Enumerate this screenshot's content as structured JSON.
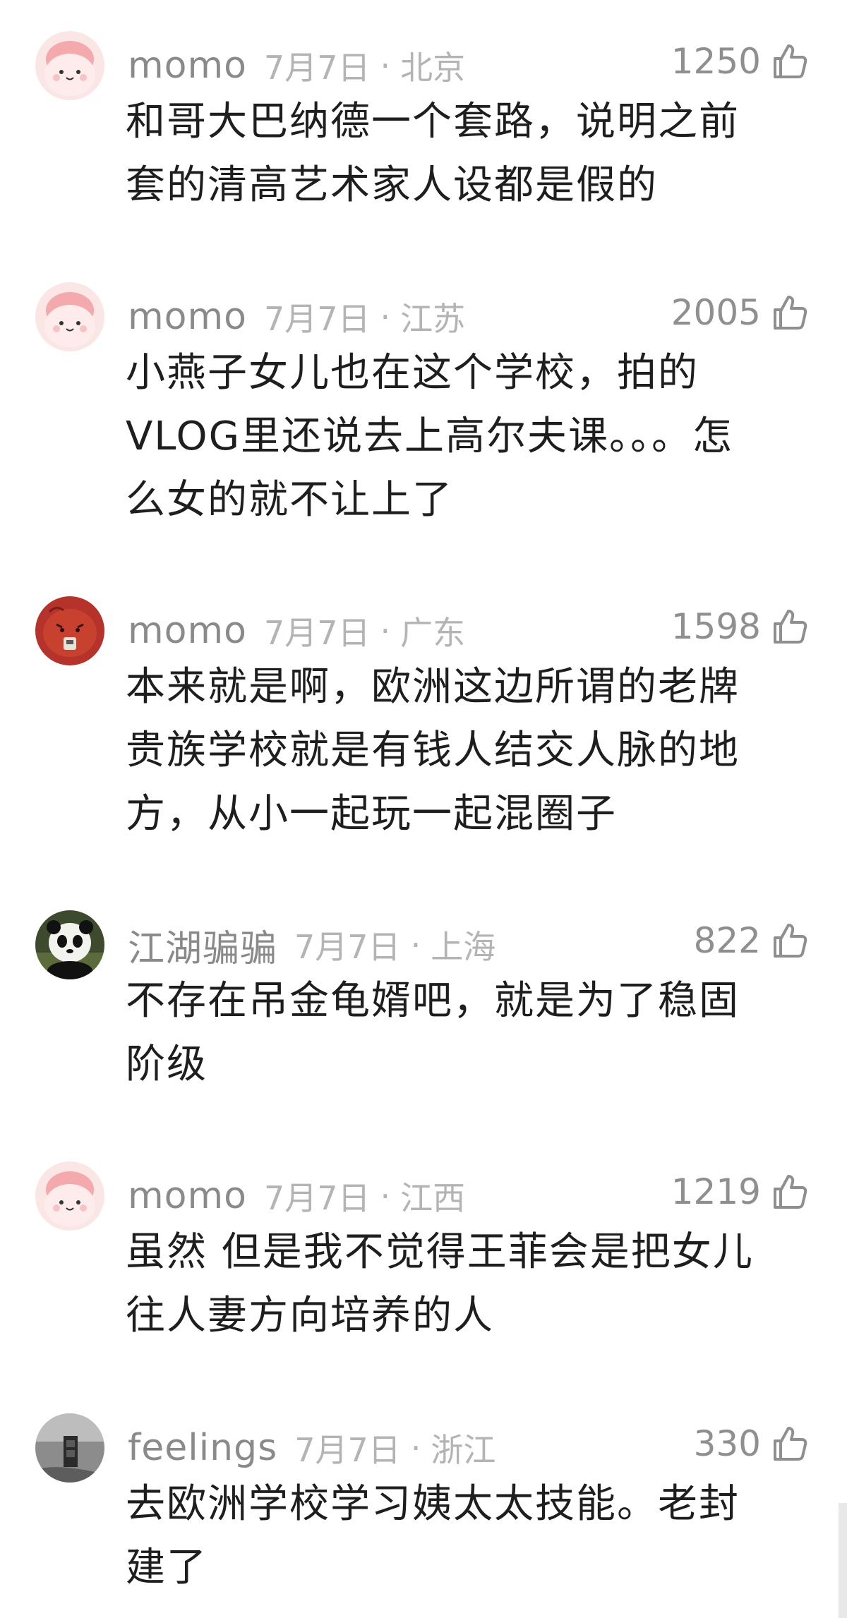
{
  "comments": [
    {
      "username": "momo",
      "date": "7月7日",
      "location": "北京",
      "likes": "1250",
      "avatar": "pink-bunny-avatar",
      "lines": [
        "和哥大巴纳德一个套路，说明之前",
        "套的清高艺术家人设都是假的"
      ]
    },
    {
      "username": "momo",
      "date": "7月7日",
      "location": "江苏",
      "likes": "2005",
      "avatar": "pink-bunny-avatar",
      "lines": [
        "小燕子女儿也在这个学校，拍的",
        "VLOG里还说去上高尔夫课。。。怎",
        "么女的就不让上了"
      ]
    },
    {
      "username": "momo",
      "date": "7月7日",
      "location": "广东",
      "likes": "1598",
      "avatar": "red-cartoon-avatar",
      "lines": [
        "本来就是啊，欧洲这边所谓的老牌",
        "贵族学校就是有钱人结交人脉的地",
        "方，从小一起玩一起混圈子"
      ]
    },
    {
      "username": "江湖骗骗",
      "date": "7月7日",
      "location": "上海",
      "likes": "822",
      "avatar": "panda-avatar",
      "lines": [
        "不存在吊金龟婿吧，就是为了稳固",
        "阶级"
      ]
    },
    {
      "username": "momo",
      "date": "7月7日",
      "location": "江西",
      "likes": "1219",
      "avatar": "pink-bunny-avatar",
      "lines": [
        "虽然 但是我不觉得王菲会是把女儿",
        "往人妻方向培养的人"
      ]
    },
    {
      "username": "feelings",
      "date": "7月7日",
      "location": "浙江",
      "likes": "330",
      "avatar": "gray-phonebooth-avatar",
      "lines": [
        "去欧洲学校学习姨太太技能。老封",
        "建了"
      ]
    }
  ],
  "meta_separator": "·",
  "colors": {
    "username": "#8a8a8a",
    "meta": "#b4b4b4",
    "content": "#1e1e1e",
    "like_icon": "#8f8f8f"
  }
}
